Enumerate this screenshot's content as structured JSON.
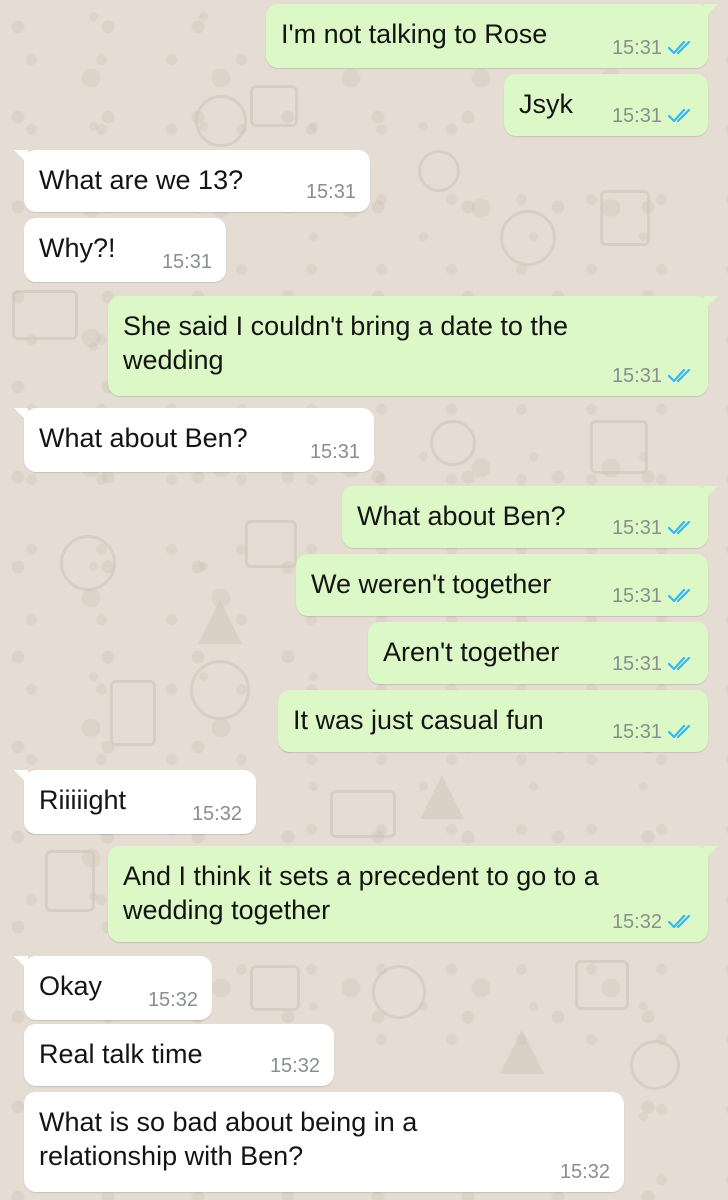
{
  "conversation": {
    "messages": [
      {
        "direction": "outgoing",
        "text": "I'm not talking to Rose",
        "time": "15:31",
        "status": "read"
      },
      {
        "direction": "outgoing",
        "text": "Jsyk",
        "time": "15:31",
        "status": "read"
      },
      {
        "direction": "incoming",
        "text": "What are we 13?",
        "time": "15:31"
      },
      {
        "direction": "incoming",
        "text": "Why?!",
        "time": "15:31"
      },
      {
        "direction": "outgoing",
        "text": "She said I couldn't bring a date to the wedding",
        "time": "15:31",
        "status": "read"
      },
      {
        "direction": "incoming",
        "text": "What about Ben?",
        "time": "15:31"
      },
      {
        "direction": "outgoing",
        "text": "What about Ben?",
        "time": "15:31",
        "status": "read"
      },
      {
        "direction": "outgoing",
        "text": "We weren't together",
        "time": "15:31",
        "status": "read"
      },
      {
        "direction": "outgoing",
        "text": "Aren't together",
        "time": "15:31",
        "status": "read"
      },
      {
        "direction": "outgoing",
        "text": "It was just casual fun",
        "time": "15:31",
        "status": "read"
      },
      {
        "direction": "incoming",
        "text": "Riiiiight",
        "time": "15:32"
      },
      {
        "direction": "outgoing",
        "text": "And I think it sets a precedent to go to a wedding together",
        "time": "15:32",
        "status": "read"
      },
      {
        "direction": "incoming",
        "text": "Okay",
        "time": "15:32"
      },
      {
        "direction": "incoming",
        "text": "Real talk time",
        "time": "15:32"
      },
      {
        "direction": "incoming",
        "text": "What is so bad about being in a relationship with Ben?",
        "time": "15:32"
      }
    ]
  },
  "colors": {
    "chat_background": "#e5ddd4",
    "incoming_bubble": "#ffffff",
    "outgoing_bubble": "#dcf8c6",
    "read_receipt": "#34b7f1",
    "timestamp": "#8a8f8b"
  },
  "icons": {
    "read_receipt": "double-check-icon"
  }
}
